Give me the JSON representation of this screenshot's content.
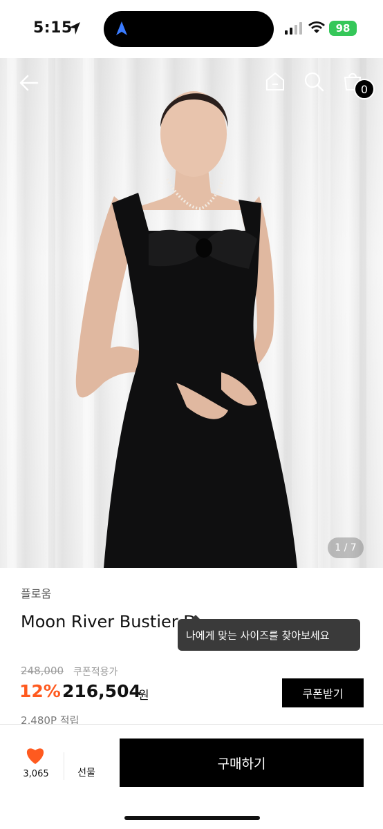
{
  "status_bar": {
    "time": "5:15",
    "battery": "98",
    "icons": [
      "location-arrow-icon",
      "signal-icon",
      "wifi-icon",
      "battery-icon"
    ]
  },
  "header": {
    "icons": [
      "back-arrow-icon",
      "home-icon",
      "search-icon",
      "shopping-bag-icon"
    ],
    "cart_count": "0"
  },
  "gallery": {
    "indicator": "1 / 7"
  },
  "product": {
    "brand": "플로움",
    "name": "Moon River Bustier D",
    "original_price": "248,000",
    "coupon_note": "쿠폰적용가",
    "discount": "12%",
    "sale_price": "216,504",
    "currency": "원",
    "coupon_button": "쿠폰받기",
    "points": "2,480P 적립"
  },
  "tooltip": {
    "text": "나에게 맞는 사이즈를 찾아보세요"
  },
  "bottom_bar": {
    "like_count": "3,065",
    "gift_label": "선물",
    "buy_label": "구매하기"
  },
  "colors": {
    "accent": "#ff5a1f",
    "primary": "#000000",
    "battery": "#35c759"
  }
}
